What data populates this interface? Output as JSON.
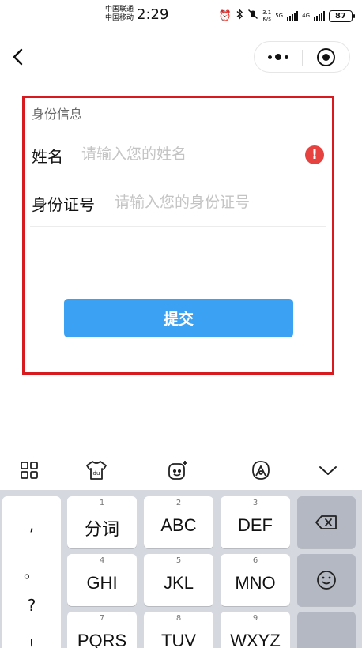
{
  "status_bar": {
    "carrier_1": "中国联通",
    "carrier_2": "中国移动",
    "time": "2:29",
    "speed_value": "3.1",
    "speed_unit": "K/s",
    "net_1": "5G",
    "net_2": "4G",
    "battery": "87"
  },
  "form": {
    "section_title": "身份信息",
    "name_label": "姓名",
    "name_placeholder": "请输入您的姓名",
    "name_value": "",
    "id_label": "身份证号",
    "id_placeholder": "请输入您的身份证号",
    "id_value": "",
    "error_mark": "!",
    "submit_label": "提交",
    "highlight_color": "#d71920",
    "button_color": "#3aa1f3"
  },
  "keyboard": {
    "keys": [
      {
        "num": "1",
        "label": "分词"
      },
      {
        "num": "2",
        "label": "ABC"
      },
      {
        "num": "3",
        "label": "DEF"
      },
      {
        "num": "4",
        "label": "GHI"
      },
      {
        "num": "5",
        "label": "JKL"
      },
      {
        "num": "6",
        "label": "MNO"
      },
      {
        "num": "7",
        "label": "PQRS"
      },
      {
        "num": "8",
        "label": "TUV"
      },
      {
        "num": "9",
        "label": "WXYZ"
      }
    ],
    "punctuation": [
      ",",
      "。",
      "?",
      "!"
    ],
    "toolbar_icons": [
      "grid-icon",
      "skin-icon",
      "emoji-sticker-icon",
      "input-method-icon",
      "chevron-down-icon"
    ],
    "right_icons": [
      "backspace-icon",
      "emoji-icon"
    ]
  }
}
